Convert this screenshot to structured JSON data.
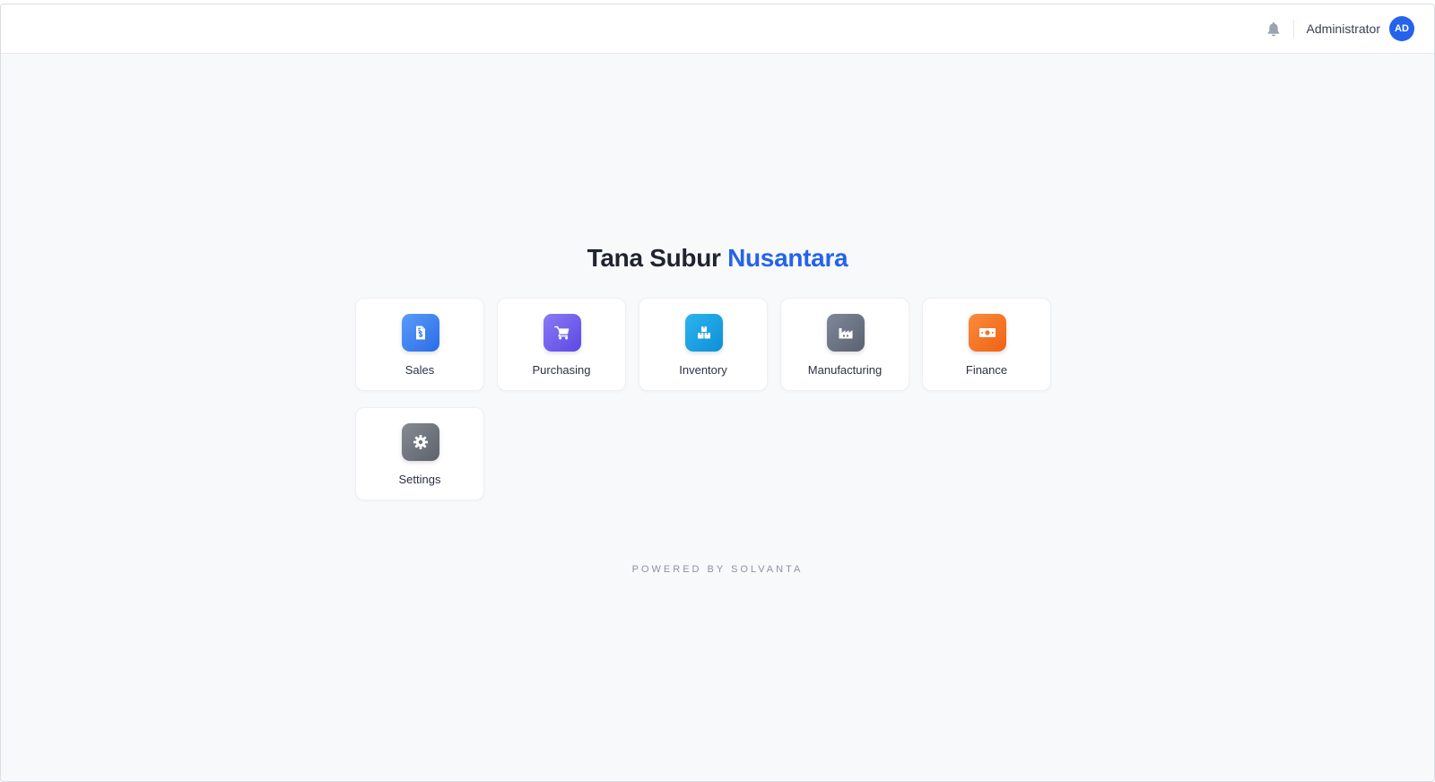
{
  "header": {
    "user_name": "Administrator",
    "avatar_initials": "AD",
    "icons": {
      "notifications": "bell-icon"
    }
  },
  "main": {
    "title_primary": "Tana Subur",
    "title_accent": "Nusantara",
    "apps": [
      {
        "label": "Sales",
        "icon": "invoice-dollar-icon",
        "colors": [
          "#5a9cf8",
          "#2b6ce8"
        ]
      },
      {
        "label": "Purchasing",
        "icon": "shopping-cart-icon",
        "colors": [
          "#8b7af6",
          "#5b48e4"
        ]
      },
      {
        "label": "Inventory",
        "icon": "boxes-icon",
        "colors": [
          "#2bb4ef",
          "#0f8fd6"
        ]
      },
      {
        "label": "Manufacturing",
        "icon": "factory-icon",
        "colors": [
          "#7f8898",
          "#5a6272"
        ]
      },
      {
        "label": "Finance",
        "icon": "money-bill-icon",
        "colors": [
          "#fb8b3c",
          "#ef6214"
        ]
      },
      {
        "label": "Settings",
        "icon": "gear-icon",
        "colors": [
          "#858a93",
          "#5d626b"
        ]
      }
    ]
  },
  "footer": {
    "text": "POWERED BY SOLVANTA"
  },
  "colors": {
    "accent": "#2563eb",
    "background": "#f8f9fb",
    "title": "#1f2430",
    "footer_text": "#8a93a3"
  }
}
